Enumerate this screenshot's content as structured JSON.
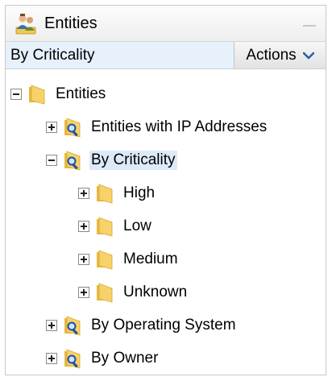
{
  "panel": {
    "title": "Entities",
    "title_icon": "user-group-icon"
  },
  "toolbar": {
    "criticality_value": "By Criticality",
    "actions_label": "Actions",
    "actions_icon": "chevron-down-icon"
  },
  "tree": {
    "root": {
      "label": "Entities",
      "expanded": true,
      "icon": "folder-icon"
    },
    "items": [
      {
        "label": "Entities with IP Addresses",
        "expanded": false,
        "icon": "folder-search-icon"
      },
      {
        "label": "By Criticality",
        "expanded": true,
        "selected": true,
        "icon": "folder-search-icon",
        "children": [
          {
            "label": "High",
            "icon": "folder-icon"
          },
          {
            "label": "Low",
            "icon": "folder-icon"
          },
          {
            "label": "Medium",
            "icon": "folder-icon"
          },
          {
            "label": "Unknown",
            "icon": "folder-icon"
          }
        ]
      },
      {
        "label": "By Operating System",
        "expanded": false,
        "icon": "folder-search-icon"
      },
      {
        "label": "By Owner",
        "expanded": false,
        "icon": "folder-search-icon"
      }
    ]
  },
  "colors": {
    "folder": "#f7d26a",
    "selection": "#dde9f8",
    "input_bg": "#e6f1fb",
    "magnifier": "#1e4fa3"
  }
}
